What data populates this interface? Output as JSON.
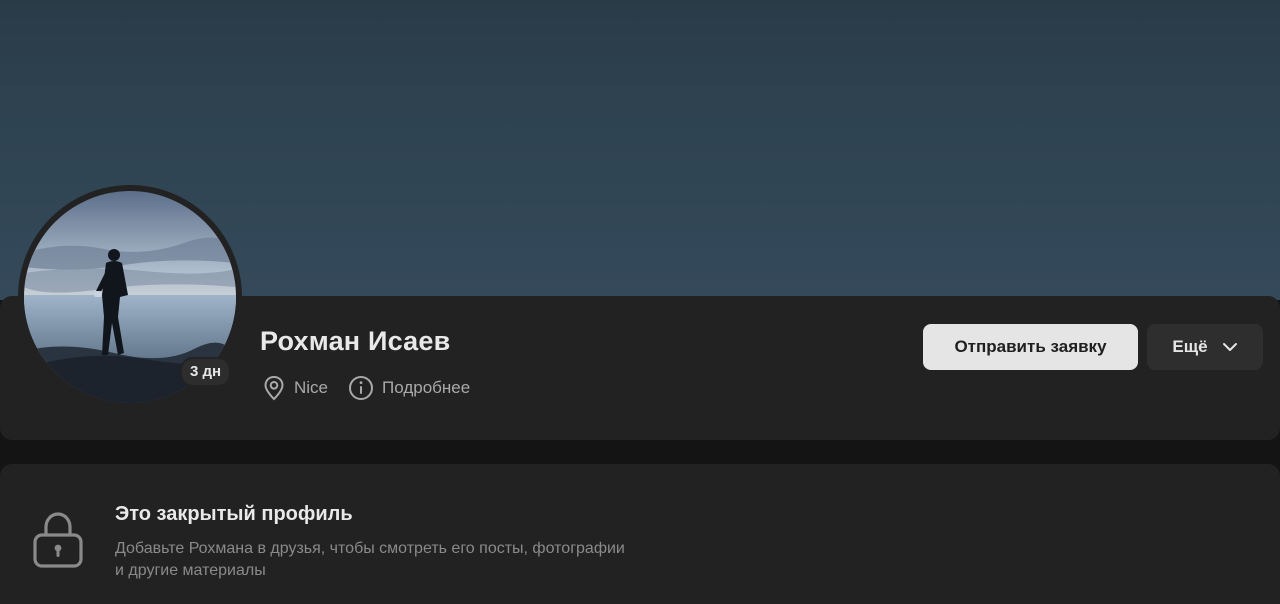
{
  "profile": {
    "name": "Рохман Исаев",
    "last_seen_badge": "3 дн",
    "location": "Nice",
    "details_label": "Подробнее"
  },
  "actions": {
    "send_request_label": "Отправить заявку",
    "more_label": "Ещё"
  },
  "private_notice": {
    "title": "Это закрытый профиль",
    "description": "Добавьте Рохмана в друзья, чтобы смотреть его посты, фотографии и другие материалы"
  },
  "icons": {
    "location": "map-pin-icon",
    "details": "info-icon",
    "more": "chevron-down-icon",
    "private": "lock-icon"
  },
  "colors": {
    "cover": "#2f4452",
    "card": "#222222",
    "primary_button": "#e5e5e5",
    "secondary_button": "#2e2e2e"
  }
}
